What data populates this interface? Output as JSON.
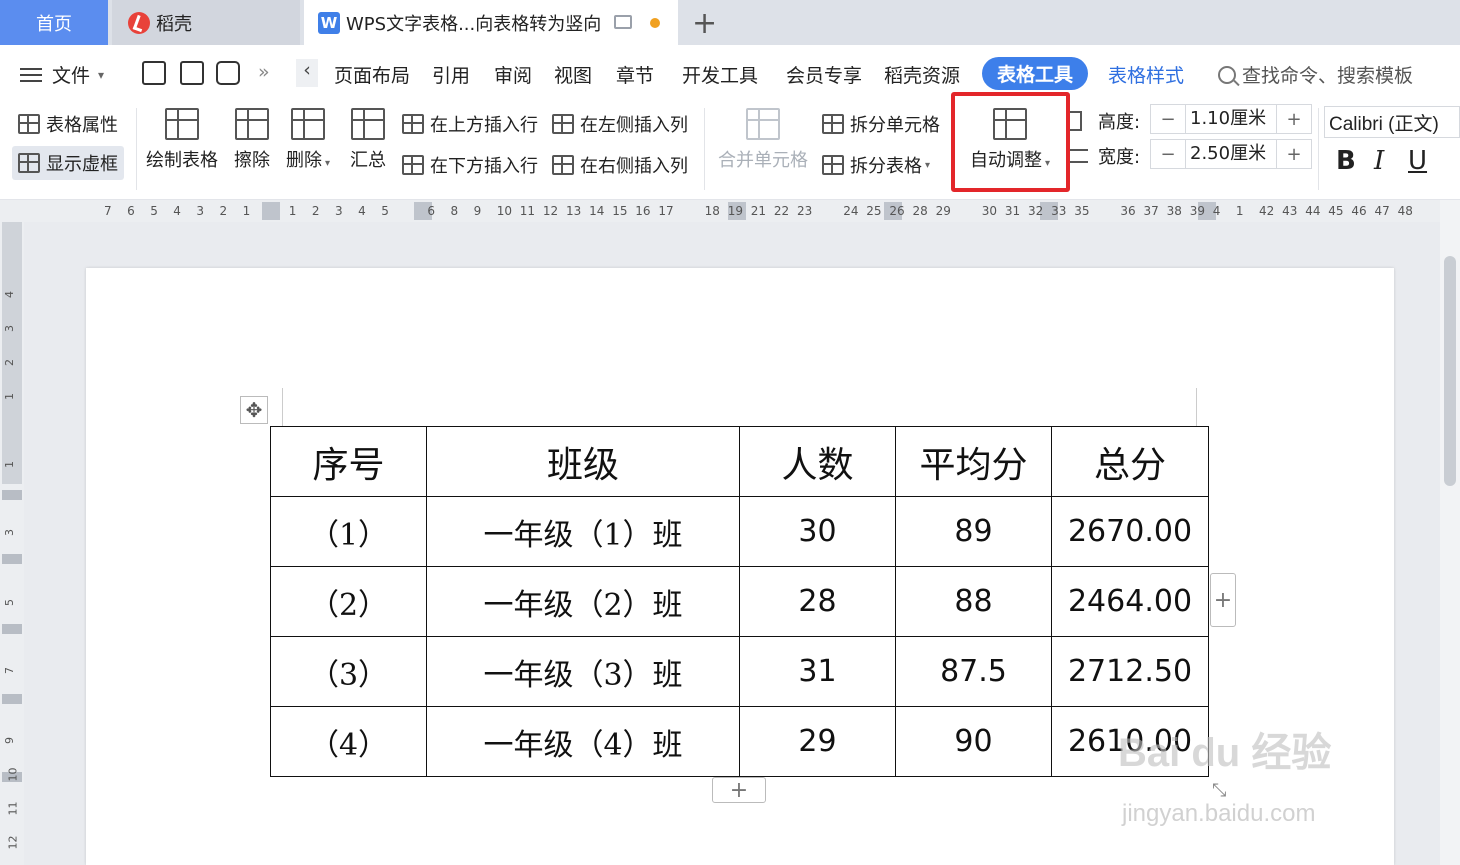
{
  "tabs": {
    "home": "首页",
    "daoke": "稻壳",
    "doc": "WPS文字表格...向表格转为竖向",
    "plus": "+"
  },
  "menu": {
    "file": "文件",
    "more": "»",
    "left": "‹",
    "items": [
      "页面布局",
      "引用",
      "审阅",
      "视图",
      "章节",
      "开发工具",
      "会员专享",
      "稻壳资源"
    ],
    "active": "表格工具",
    "style": "表格样式",
    "search": "查找命令、搜索模板"
  },
  "ribbon": {
    "table_props": "表格属性",
    "show_grid": "显示虚框",
    "draw_table": "绘制表格",
    "erase": "擦除",
    "delete": "删除",
    "summary": "汇总",
    "insert_above": "在上方插入行",
    "insert_below": "在下方插入行",
    "insert_left": "在左侧插入列",
    "insert_right": "在右侧插入列",
    "merge_cells": "合并单元格",
    "split_cells": "拆分单元格",
    "split_table": "拆分表格",
    "auto_fit": "自动调整",
    "height_label": "高度:",
    "height_value": "1.10厘米",
    "width_label": "宽度:",
    "width_value": "2.50厘米",
    "minus": "−",
    "plus": "+",
    "font": "Calibri (正文)",
    "bold": "B",
    "italic": "I",
    "underline": "U"
  },
  "ruler": {
    "h_numbers": [
      "7",
      "6",
      "5",
      "4",
      "3",
      "2",
      "1",
      "1",
      "2",
      "3",
      "4",
      "5",
      "6",
      "8",
      "9",
      "10",
      "11",
      "12",
      "13",
      "14",
      "15",
      "16",
      "17",
      "18",
      "19",
      "21",
      "22",
      "23",
      "24",
      "25",
      "26",
      "28",
      "29",
      "30",
      "31",
      "32",
      "33",
      "35",
      "36",
      "37",
      "38",
      "39",
      "4",
      "1",
      "42",
      "43",
      "44",
      "45",
      "46",
      "47",
      "48"
    ],
    "v_numbers": [
      "4",
      "3",
      "2",
      "1",
      "1",
      "3",
      "5",
      "7",
      "9",
      "10",
      "11",
      "12"
    ]
  },
  "table": {
    "headers": [
      "序号",
      "班级",
      "人数",
      "平均分",
      "总分"
    ],
    "rows": [
      [
        "（1）",
        "一年级（1）班",
        "30",
        "89",
        "2670.00"
      ],
      [
        "（2）",
        "一年级（2）班",
        "28",
        "88",
        "2464.00"
      ],
      [
        "（3）",
        "一年级（3）班",
        "31",
        "87.5",
        "2712.50"
      ],
      [
        "（4）",
        "一年级（4）班",
        "29",
        "90",
        "2610.00"
      ]
    ]
  },
  "watermark": {
    "main": "Bai du 经验",
    "sub": "jingyan.baidu.com"
  },
  "colors": {
    "accent": "#3d7fea",
    "highlight": "#e3262a",
    "home_tab": "#5b8def"
  }
}
